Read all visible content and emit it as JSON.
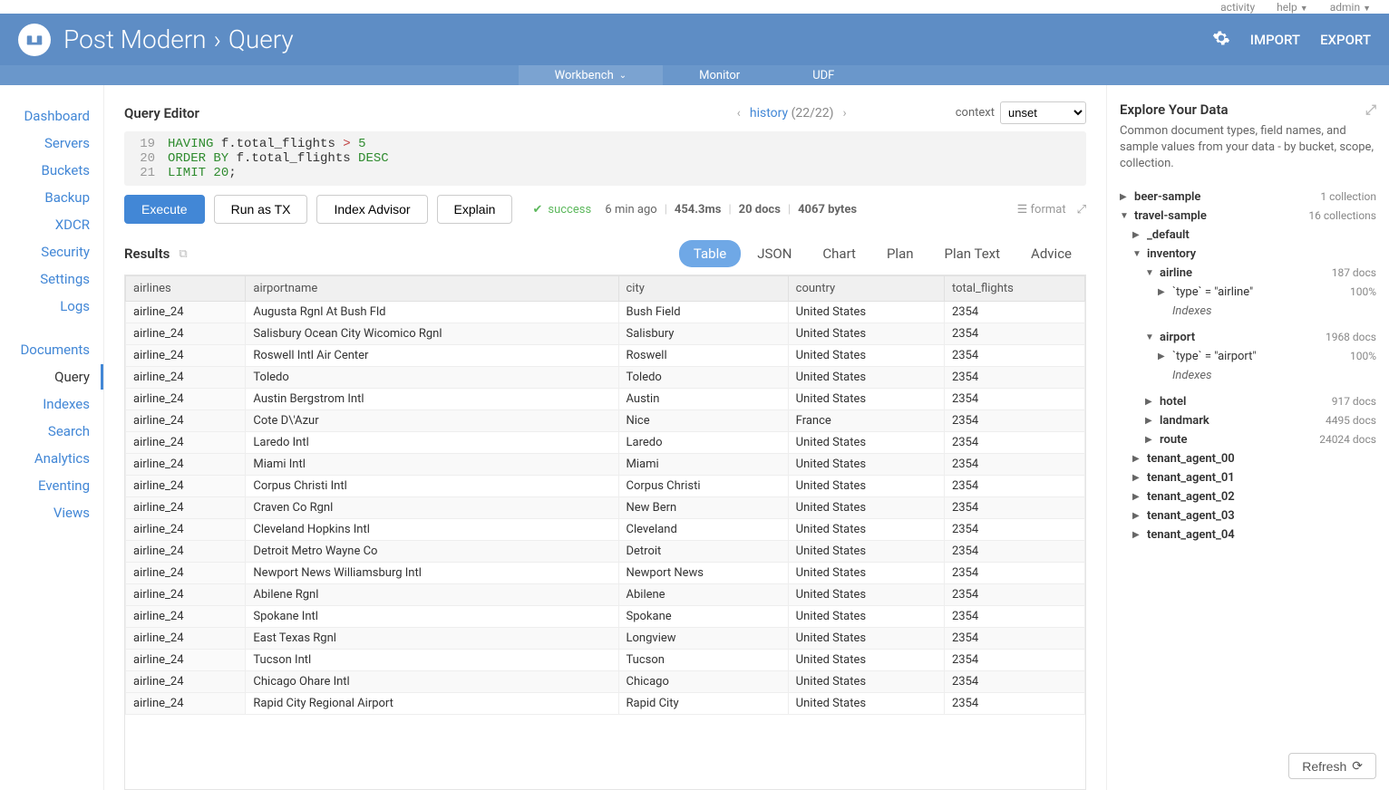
{
  "topbar": {
    "activity": "activity",
    "help": "help",
    "admin": "admin"
  },
  "header": {
    "brand": "Post Modern",
    "section": "Query",
    "import": "IMPORT",
    "export": "EXPORT"
  },
  "tabs": {
    "workbench": "Workbench",
    "monitor": "Monitor",
    "udf": "UDF"
  },
  "sidebar": {
    "items": [
      "Dashboard",
      "Servers",
      "Buckets",
      "Backup",
      "XDCR",
      "Security",
      "Settings",
      "Logs"
    ],
    "items2": [
      "Documents",
      "Query",
      "Indexes",
      "Search",
      "Analytics",
      "Eventing",
      "Views"
    ],
    "active": "Query"
  },
  "editor": {
    "title": "Query Editor",
    "history_label": "history",
    "history_count": "(22/22)",
    "context_label": "context",
    "context_value": "unset",
    "lines": [
      {
        "n": 19,
        "tokens": [
          {
            "t": "HAVING",
            "c": "kw"
          },
          {
            "t": " f.total_flights ",
            "c": ""
          },
          {
            "t": ">",
            "c": "op"
          },
          {
            "t": " ",
            "c": ""
          },
          {
            "t": "5",
            "c": "num"
          }
        ]
      },
      {
        "n": 20,
        "tokens": [
          {
            "t": "ORDER BY",
            "c": "kw"
          },
          {
            "t": " f.total_flights ",
            "c": ""
          },
          {
            "t": "DESC",
            "c": "kw"
          }
        ]
      },
      {
        "n": 21,
        "tokens": [
          {
            "t": "LIMIT",
            "c": "kw"
          },
          {
            "t": " ",
            "c": ""
          },
          {
            "t": "20",
            "c": "num"
          },
          {
            "t": ";",
            "c": ""
          }
        ]
      }
    ]
  },
  "buttons": {
    "execute": "Execute",
    "runastx": "Run as TX",
    "indexadvisor": "Index Advisor",
    "explain": "Explain"
  },
  "status": {
    "success": "success",
    "time": "6 min ago",
    "duration": "454.3ms",
    "docs": "20 docs",
    "bytes": "4067 bytes",
    "format": "format"
  },
  "results": {
    "title": "Results",
    "tabs": [
      "Table",
      "JSON",
      "Chart",
      "Plan",
      "Plan Text",
      "Advice"
    ],
    "active": "Table",
    "columns": [
      "airlines",
      "airportname",
      "city",
      "country",
      "total_flights"
    ],
    "rows": [
      [
        "airline_24",
        "Augusta Rgnl At Bush Fld",
        "Bush Field",
        "United States",
        "2354"
      ],
      [
        "airline_24",
        "Salisbury Ocean City Wicomico Rgnl",
        "Salisbury",
        "United States",
        "2354"
      ],
      [
        "airline_24",
        "Roswell Intl Air Center",
        "Roswell",
        "United States",
        "2354"
      ],
      [
        "airline_24",
        "Toledo",
        "Toledo",
        "United States",
        "2354"
      ],
      [
        "airline_24",
        "Austin Bergstrom Intl",
        "Austin",
        "United States",
        "2354"
      ],
      [
        "airline_24",
        "Cote D\\'Azur",
        "Nice",
        "France",
        "2354"
      ],
      [
        "airline_24",
        "Laredo Intl",
        "Laredo",
        "United States",
        "2354"
      ],
      [
        "airline_24",
        "Miami Intl",
        "Miami",
        "United States",
        "2354"
      ],
      [
        "airline_24",
        "Corpus Christi Intl",
        "Corpus Christi",
        "United States",
        "2354"
      ],
      [
        "airline_24",
        "Craven Co Rgnl",
        "New Bern",
        "United States",
        "2354"
      ],
      [
        "airline_24",
        "Cleveland Hopkins Intl",
        "Cleveland",
        "United States",
        "2354"
      ],
      [
        "airline_24",
        "Detroit Metro Wayne Co",
        "Detroit",
        "United States",
        "2354"
      ],
      [
        "airline_24",
        "Newport News Williamsburg Intl",
        "Newport News",
        "United States",
        "2354"
      ],
      [
        "airline_24",
        "Abilene Rgnl",
        "Abilene",
        "United States",
        "2354"
      ],
      [
        "airline_24",
        "Spokane Intl",
        "Spokane",
        "United States",
        "2354"
      ],
      [
        "airline_24",
        "East Texas Rgnl",
        "Longview",
        "United States",
        "2354"
      ],
      [
        "airline_24",
        "Tucson Intl",
        "Tucson",
        "United States",
        "2354"
      ],
      [
        "airline_24",
        "Chicago Ohare Intl",
        "Chicago",
        "United States",
        "2354"
      ],
      [
        "airline_24",
        "Rapid City Regional Airport",
        "Rapid City",
        "United States",
        "2354"
      ]
    ]
  },
  "rightPanel": {
    "title": "Explore Your Data",
    "desc": "Common document types, field names, and sample values from your data - by bucket, scope, collection.",
    "refresh": "Refresh",
    "tree": [
      {
        "indent": 0,
        "toggle": "▶",
        "label": "beer-sample",
        "bold": true,
        "meta": "1 collection"
      },
      {
        "indent": 0,
        "toggle": "▼",
        "label": "travel-sample",
        "bold": true,
        "meta": "16 collections"
      },
      {
        "indent": 1,
        "toggle": "▶",
        "label": "_default",
        "bold": true,
        "meta": ""
      },
      {
        "indent": 1,
        "toggle": "▼",
        "label": "inventory",
        "bold": true,
        "meta": ""
      },
      {
        "indent": 2,
        "toggle": "▼",
        "label": "airline",
        "bold": true,
        "meta": "187 docs"
      },
      {
        "indent": 3,
        "toggle": "▶",
        "label": "`type` = \"airline\"",
        "bold": false,
        "meta": "100%"
      },
      {
        "indent": 3,
        "toggle": "",
        "label": "Indexes",
        "bold": false,
        "italic": true,
        "meta": ""
      },
      {
        "indent": 2,
        "toggle": "▼",
        "label": "airport",
        "bold": true,
        "meta": "1968 docs"
      },
      {
        "indent": 3,
        "toggle": "▶",
        "label": "`type` = \"airport\"",
        "bold": false,
        "meta": "100%"
      },
      {
        "indent": 3,
        "toggle": "",
        "label": "Indexes",
        "bold": false,
        "italic": true,
        "meta": ""
      },
      {
        "indent": 2,
        "toggle": "▶",
        "label": "hotel",
        "bold": true,
        "meta": "917 docs"
      },
      {
        "indent": 2,
        "toggle": "▶",
        "label": "landmark",
        "bold": true,
        "meta": "4495 docs"
      },
      {
        "indent": 2,
        "toggle": "▶",
        "label": "route",
        "bold": true,
        "meta": "24024 docs"
      },
      {
        "indent": 1,
        "toggle": "▶",
        "label": "tenant_agent_00",
        "bold": true,
        "meta": ""
      },
      {
        "indent": 1,
        "toggle": "▶",
        "label": "tenant_agent_01",
        "bold": true,
        "meta": ""
      },
      {
        "indent": 1,
        "toggle": "▶",
        "label": "tenant_agent_02",
        "bold": true,
        "meta": ""
      },
      {
        "indent": 1,
        "toggle": "▶",
        "label": "tenant_agent_03",
        "bold": true,
        "meta": ""
      },
      {
        "indent": 1,
        "toggle": "▶",
        "label": "tenant_agent_04",
        "bold": true,
        "meta": ""
      }
    ]
  }
}
